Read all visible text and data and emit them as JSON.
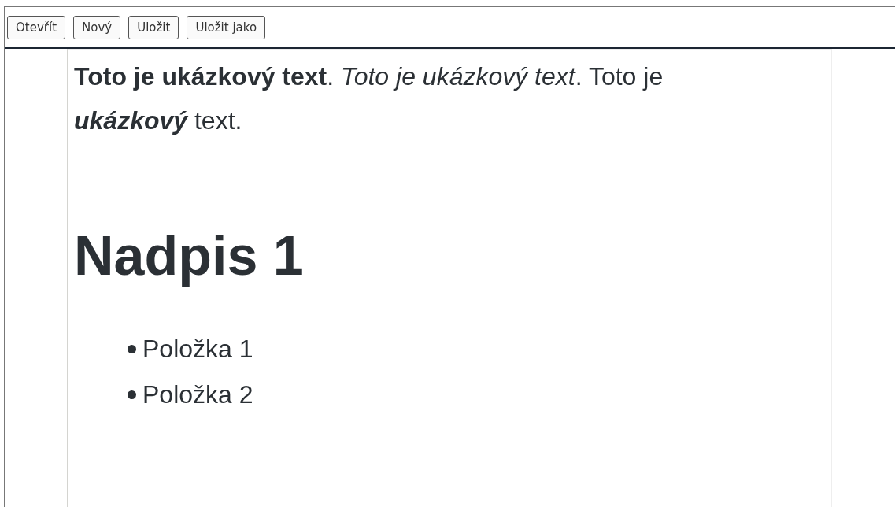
{
  "toolbar": {
    "buttons": [
      "Otevřít",
      "Nový",
      "Uložit",
      "Uložit jako"
    ]
  },
  "document": {
    "paragraph": [
      {
        "text": "Toto je ukázkový text",
        "bold": true,
        "italic": false
      },
      {
        "text": ". ",
        "bold": false,
        "italic": false
      },
      {
        "text": "Toto je ukázkový text",
        "bold": false,
        "italic": true
      },
      {
        "text": ". Toto je ",
        "bold": false,
        "italic": false
      },
      {
        "text": "ukázkový",
        "bold": true,
        "italic": true
      },
      {
        "text": " text.",
        "bold": false,
        "italic": false
      }
    ],
    "heading": "Nadpis 1",
    "list_items": [
      "Položka 1",
      "Položka 2"
    ]
  }
}
